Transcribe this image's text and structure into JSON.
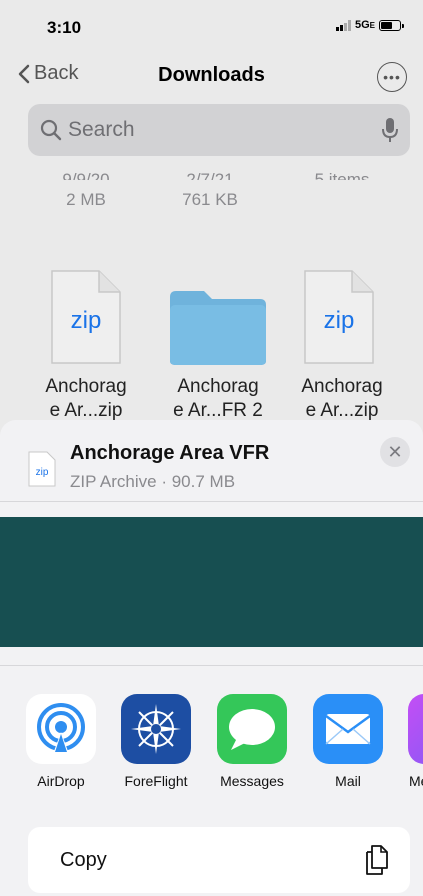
{
  "status": {
    "time": "3:10",
    "network": "5G",
    "network_suffix": "E",
    "battery_level": 0.6
  },
  "nav": {
    "back_label": "Back",
    "title": "Downloads"
  },
  "search": {
    "placeholder": "Search"
  },
  "files_top": [
    {
      "date": "9/9/20",
      "size": "2 MB"
    },
    {
      "date": "2/7/21",
      "size": "761 KB"
    },
    {
      "date": "5 items",
      "size": ""
    }
  ],
  "files": [
    {
      "type": "zip",
      "icon_text": "zip",
      "name_line1": "Anchorag",
      "name_line2": "e Ar...zip"
    },
    {
      "type": "folder",
      "icon_text": "",
      "name_line1": "Anchorag",
      "name_line2": "e Ar...FR 2"
    },
    {
      "type": "zip",
      "icon_text": "zip",
      "name_line1": "Anchorag",
      "name_line2": "e Ar...zip"
    }
  ],
  "share_sheet": {
    "file_icon_text": "zip",
    "title": "Anchorage Area VFR",
    "subtitle": "ZIP Archive · 90.7 MB",
    "apps": [
      {
        "label": "AirDrop",
        "icon": "airdrop-icon"
      },
      {
        "label": "ForeFlight",
        "icon": "foreflight-icon"
      },
      {
        "label": "Messages",
        "icon": "messages-icon"
      },
      {
        "label": "Mail",
        "icon": "mail-icon"
      },
      {
        "label": "Me",
        "icon": "more-apps-icon"
      }
    ],
    "actions": [
      {
        "label": "Copy",
        "icon": "copy-icon"
      }
    ]
  },
  "colors": {
    "banner": "#174f51",
    "link_blue": "#1a73e8",
    "folder": "#6fb3dc"
  }
}
